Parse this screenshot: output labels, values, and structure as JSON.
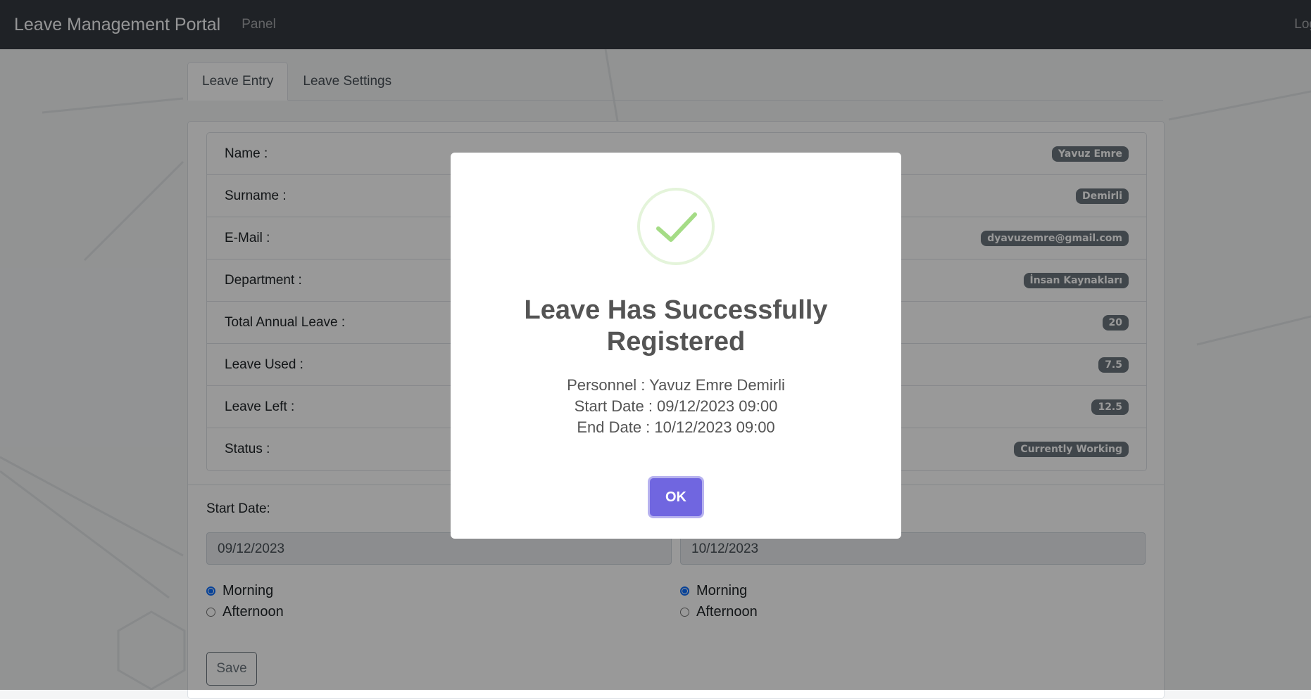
{
  "navbar": {
    "brand": "Leave Management Portal",
    "panel_link": "Panel",
    "logout": "Log"
  },
  "tabs": [
    {
      "label": "Leave Entry",
      "active": true
    },
    {
      "label": "Leave Settings",
      "active": false
    }
  ],
  "info": [
    {
      "label": "Name :",
      "value": "Yavuz Emre"
    },
    {
      "label": "Surname :",
      "value": "Demirli"
    },
    {
      "label": "E-Mail :",
      "value": "dyavuzemre@gmail.com"
    },
    {
      "label": "Department :",
      "value": "İnsan Kaynakları"
    },
    {
      "label": "Total Annual Leave :",
      "value": "20"
    },
    {
      "label": "Leave Used :",
      "value": "7.5"
    },
    {
      "label": "Leave Left :",
      "value": "12.5"
    },
    {
      "label": "Status :",
      "value": "Currently Working"
    }
  ],
  "form": {
    "start_label": "Start Date:",
    "start_value": "09/12/2023",
    "end_value": "10/12/2023",
    "start_period": {
      "options": [
        "Morning",
        "Afternoon"
      ],
      "selected": "Morning"
    },
    "end_period": {
      "options": [
        "Morning",
        "Afternoon"
      ],
      "selected": "Morning"
    },
    "save_label": "Save"
  },
  "modal": {
    "icon": "success-check-icon",
    "title_line1": "Leave Has Successfully",
    "title_line2": "Registered",
    "personnel": "Personnel : Yavuz Emre Demirli",
    "start": "Start Date : 09/12/2023 09:00",
    "end": "End Date : 10/12/2023 09:00",
    "ok_label": "OK"
  },
  "colors": {
    "navbar": "#343a40",
    "badge": "#6c757d",
    "ok_button": "#7066e0",
    "success_check": "#a5dc86",
    "radio_checked": "#0d6efd"
  }
}
